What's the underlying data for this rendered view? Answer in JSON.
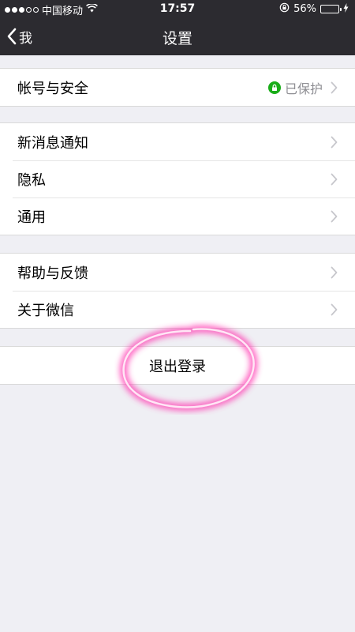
{
  "status_bar": {
    "signal_dots": [
      true,
      true,
      true,
      false,
      false
    ],
    "carrier": "中国移动",
    "wifi_icon": "wifi-icon",
    "time": "17:57",
    "rotation_lock_icon": "rotation-lock-icon",
    "battery_percent_text": "56%",
    "battery_level": 0.56,
    "charging_icon": "bolt-icon"
  },
  "navbar": {
    "back_label": "我",
    "title": "设置"
  },
  "groups": [
    {
      "items": [
        {
          "label": "帐号与安全",
          "detail": "已保护",
          "detail_icon": "lock-icon"
        }
      ]
    },
    {
      "items": [
        {
          "label": "新消息通知"
        },
        {
          "label": "隐私"
        },
        {
          "label": "通用"
        }
      ]
    },
    {
      "items": [
        {
          "label": "帮助与反馈"
        },
        {
          "label": "关于微信"
        }
      ]
    }
  ],
  "logout": {
    "label": "退出登录"
  },
  "colors": {
    "nav_background": "#2c2b30",
    "page_background": "#efeff4",
    "protected_green": "#1aad19",
    "battery_green": "#4cd964",
    "annotation_pink": "#ff3fb4"
  }
}
